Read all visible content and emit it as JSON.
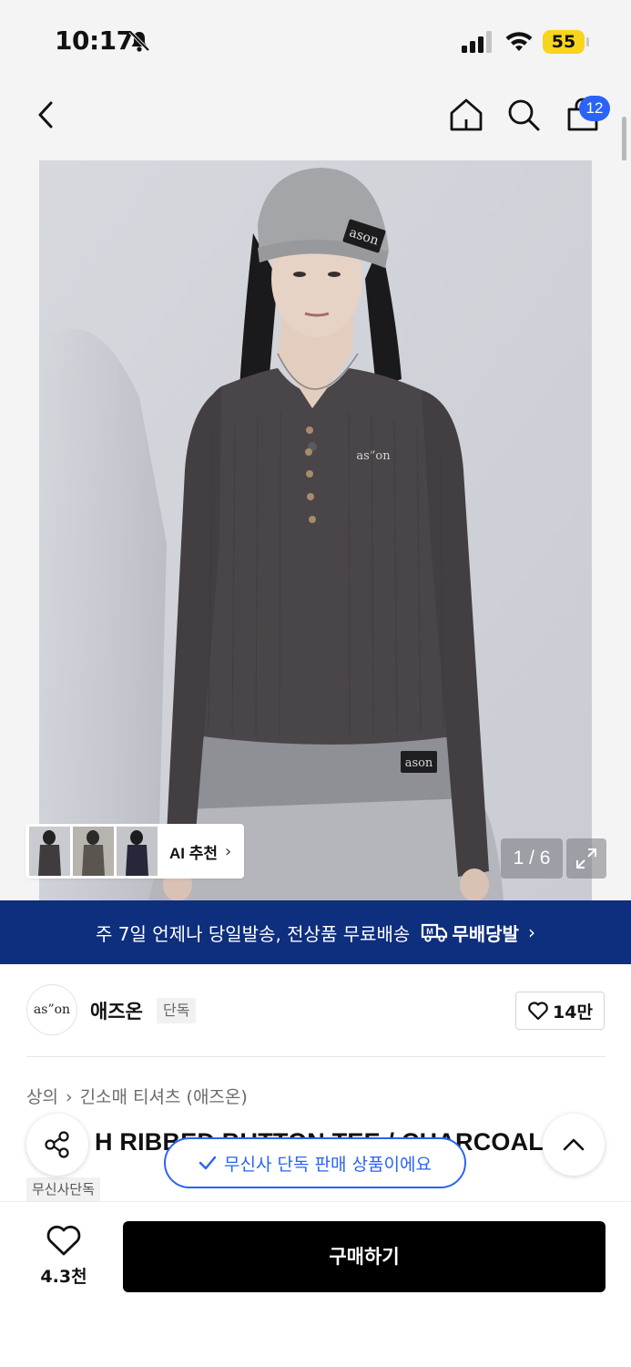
{
  "status_bar": {
    "time": "10:17",
    "battery": "55"
  },
  "nav": {
    "cart_count": "12"
  },
  "gallery": {
    "counter": "1 / 6",
    "ai_label": "AI 추천"
  },
  "shipping_banner": {
    "text": "주 7일 언제나 당일발송, 전상품 무료배송",
    "logo_text": "무배당발"
  },
  "brand": {
    "logo_text": "as”on",
    "name": "애즈온",
    "tag": "단독",
    "likes": "14만"
  },
  "breadcrumb": [
    "상의",
    "긴소매 티셔츠 (애즈온)"
  ],
  "product": {
    "title": "H RIBBED BUTTON TEE / CHARCOAL",
    "tag": "무신사단독",
    "exclusive_notice": "무신사 단독 판매 상품이에요"
  },
  "print_marks": {
    "beanie_label": "ason",
    "shirt_logo": "as”on",
    "skirt_label": "ason"
  },
  "bottom_bar": {
    "wish_count": "4.3천",
    "buy_label": "구매하기"
  },
  "colors": {
    "accent_blue": "#2a63f5",
    "banner_navy": "#0e2e7e",
    "buy_black": "#000000",
    "battery_yellow": "#f7d51d"
  }
}
